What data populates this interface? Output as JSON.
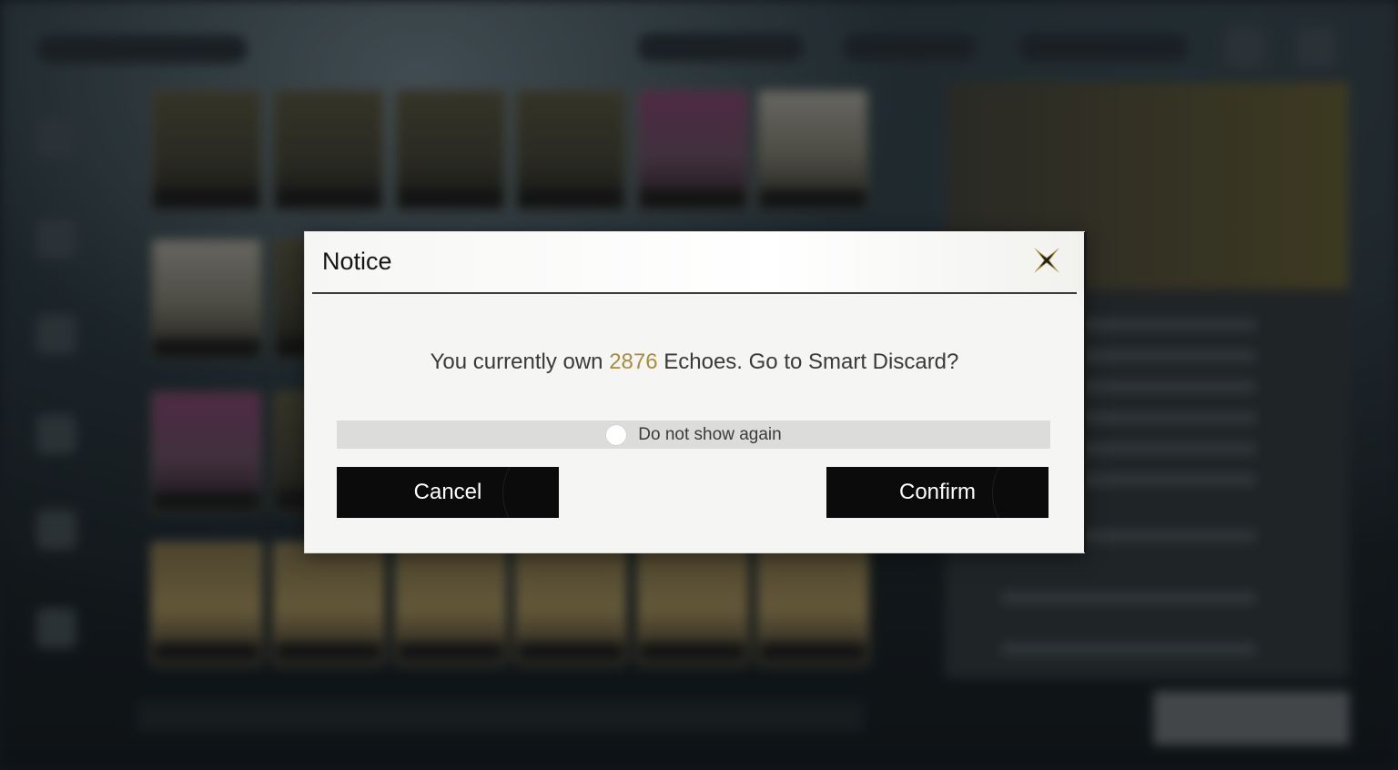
{
  "dialog": {
    "title": "Notice",
    "message_prefix": "You currently own ",
    "echo_count": "2876",
    "message_suffix": " Echoes. Go to Smart Discard?",
    "dont_show_label": "Do not show again",
    "cancel_label": "Cancel",
    "confirm_label": "Confirm"
  },
  "colors": {
    "highlight": "#a98c3e",
    "button_bg": "#0b0b0b",
    "dialog_bg": "#f5f5f3"
  },
  "icons": {
    "close": "close-icon"
  }
}
